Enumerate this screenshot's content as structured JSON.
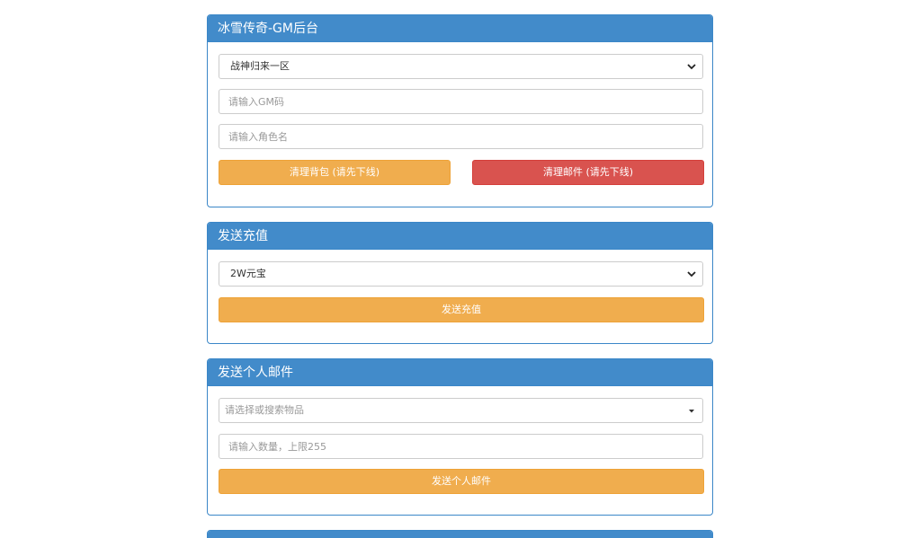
{
  "panel_gm": {
    "title": "冰雪传奇-GM后台",
    "server_select": "战神归来一区",
    "gm_code_placeholder": "请输入GM码",
    "role_name_placeholder": "请输入角色名",
    "clear_bag_label": "清理背包 (请先下线)",
    "clear_mail_label": "清理邮件 (请先下线)"
  },
  "panel_recharge": {
    "title": "发送充值",
    "amount_select": "2W元宝",
    "send_label": "发送充值"
  },
  "panel_mail": {
    "title": "发送个人邮件",
    "item_select_placeholder": "请选择或搜索物品",
    "quantity_placeholder": "请输入数量，上限255",
    "send_label": "发送个人邮件"
  },
  "colors": {
    "panel_header": "#428bca",
    "warning": "#f0ad4e",
    "danger": "#d9534f"
  },
  "icons": {
    "select_arrow": "chevron-down-icon",
    "combo_arrow": "caret-down-icon"
  }
}
